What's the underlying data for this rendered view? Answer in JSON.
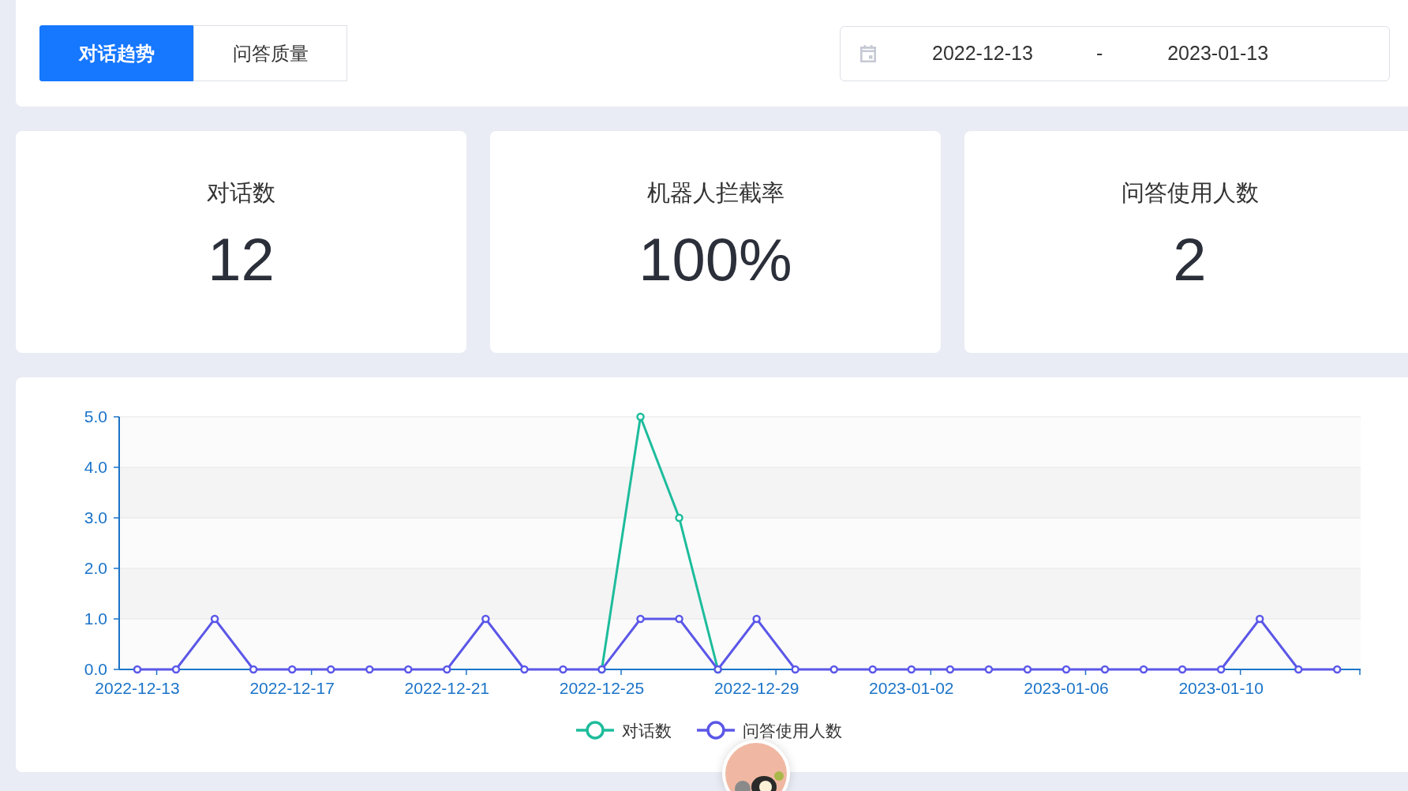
{
  "tabs": [
    {
      "label": "对话趋势",
      "selected": true
    },
    {
      "label": "问答质量",
      "selected": false
    }
  ],
  "date_range": {
    "start": "2022-12-13",
    "separator": "-",
    "end": "2023-01-13"
  },
  "stats": [
    {
      "label": "对话数",
      "value": "12"
    },
    {
      "label": "机器人拦截率",
      "value": "100%"
    },
    {
      "label": "问答使用人数",
      "value": "2"
    }
  ],
  "chart": {
    "chart_data": {
      "type": "line",
      "categories": [
        "2022-12-13",
        null,
        null,
        null,
        "2022-12-17",
        null,
        null,
        null,
        "2022-12-21",
        null,
        null,
        null,
        "2022-12-25",
        null,
        null,
        null,
        "2022-12-29",
        null,
        null,
        null,
        "2023-01-02",
        null,
        null,
        null,
        "2023-01-06",
        null,
        null,
        null,
        "2023-01-10",
        null,
        null,
        null
      ],
      "yticks": [
        {
          "value": 0,
          "label": "0.0"
        },
        {
          "value": 1,
          "label": "1.0"
        },
        {
          "value": 2,
          "label": "2.0"
        },
        {
          "value": 3,
          "label": "3.0"
        },
        {
          "value": 4,
          "label": "4.0"
        },
        {
          "value": 5,
          "label": "5.0"
        }
      ],
      "ylim": [
        0,
        5
      ],
      "grid": true,
      "legend": "bottom",
      "series": [
        {
          "name": "对话数",
          "color": "#1dbc9c",
          "marker": "circle",
          "values": [
            null,
            null,
            null,
            null,
            null,
            null,
            null,
            null,
            null,
            null,
            null,
            null,
            0,
            5,
            3,
            0,
            null,
            null,
            null,
            null,
            null,
            null,
            null,
            null,
            null,
            null,
            null,
            null,
            null,
            null,
            null,
            null
          ]
        },
        {
          "name": "问答使用人数",
          "color": "#5b57e8",
          "marker": "circle",
          "values": [
            0,
            0,
            1,
            0,
            0,
            0,
            0,
            0,
            0,
            1,
            0,
            0,
            0,
            1,
            1,
            0,
            1,
            0,
            0,
            0,
            0,
            0,
            0,
            0,
            0,
            0,
            0,
            0,
            0,
            1,
            0,
            0
          ]
        }
      ]
    }
  }
}
